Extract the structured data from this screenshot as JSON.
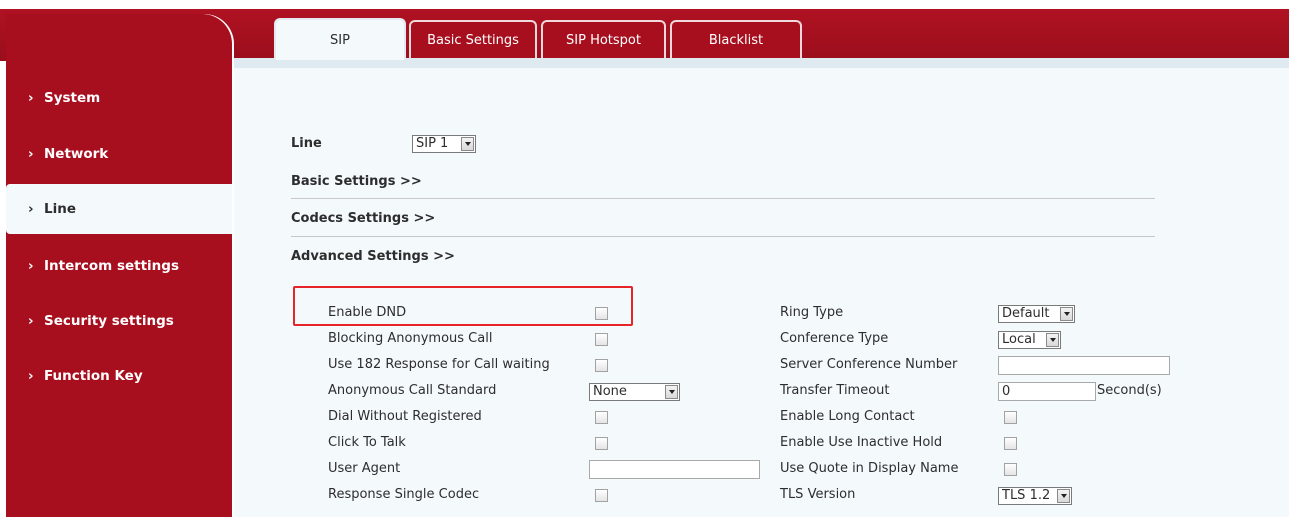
{
  "tabs": [
    {
      "label": "SIP",
      "active": true
    },
    {
      "label": "Basic Settings",
      "active": false
    },
    {
      "label": "SIP Hotspot",
      "active": false
    },
    {
      "label": "Blacklist",
      "active": false
    }
  ],
  "sidebar": {
    "arrow": "›",
    "items": [
      {
        "label": "System",
        "active": false
      },
      {
        "label": "Network",
        "active": false
      },
      {
        "label": "Line",
        "active": true
      },
      {
        "label": "Intercom settings",
        "active": false
      },
      {
        "label": "Security settings",
        "active": false
      },
      {
        "label": "Function Key",
        "active": false
      }
    ]
  },
  "line": {
    "label": "Line",
    "value": "SIP 1"
  },
  "sections": {
    "basic": "Basic Settings >>",
    "codecs": "Codecs Settings >>",
    "advanced": "Advanced Settings >>"
  },
  "left_fields": [
    {
      "label": "Enable DND",
      "type": "checkbox",
      "checked": false
    },
    {
      "label": "Blocking Anonymous Call",
      "type": "checkbox",
      "checked": false
    },
    {
      "label": "Use 182 Response for Call waiting",
      "type": "checkbox",
      "checked": false
    },
    {
      "label": "Anonymous Call Standard",
      "type": "select",
      "value": "None"
    },
    {
      "label": "Dial Without Registered",
      "type": "checkbox",
      "checked": false
    },
    {
      "label": "Click To Talk",
      "type": "checkbox",
      "checked": false
    },
    {
      "label": "User Agent",
      "type": "text",
      "value": ""
    },
    {
      "label": "Response Single Codec",
      "type": "checkbox",
      "checked": false
    }
  ],
  "right_fields": [
    {
      "label": "Ring Type",
      "type": "select",
      "value": "Default"
    },
    {
      "label": "Conference Type",
      "type": "select",
      "value": "Local"
    },
    {
      "label": "Server Conference Number",
      "type": "text",
      "value": ""
    },
    {
      "label": "Transfer Timeout",
      "type": "text",
      "value": "0",
      "unit": "Second(s)"
    },
    {
      "label": "Enable Long Contact",
      "type": "checkbox",
      "checked": false
    },
    {
      "label": "Enable Use Inactive Hold",
      "type": "checkbox",
      "checked": false
    },
    {
      "label": "Use Quote in Display Name",
      "type": "checkbox",
      "checked": false
    },
    {
      "label": "TLS Version",
      "type": "select",
      "value": "TLS 1.2"
    }
  ],
  "colors": {
    "brand": "#a80f1e",
    "highlight": "#e8242b",
    "content_bg": "#f4f9fc"
  }
}
